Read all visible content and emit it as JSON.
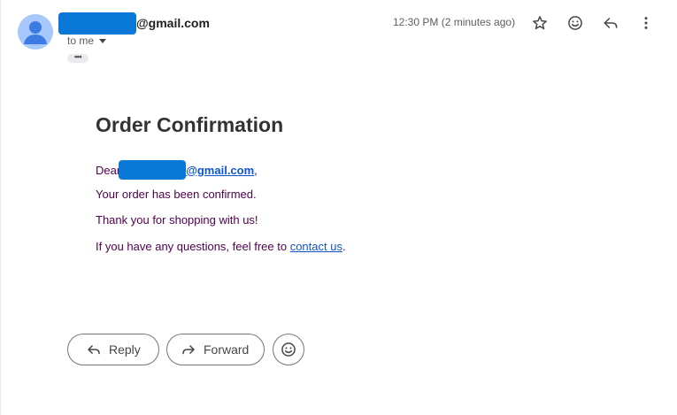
{
  "header": {
    "sender_visible_suffix": "@gmail.com",
    "recipient_label": "to me",
    "trimmed_content_label": "•••",
    "timestamp": "12:30 PM (2 minutes ago)",
    "icons": [
      "star-icon",
      "emoji-icon",
      "reply-icon",
      "more-vert-icon"
    ]
  },
  "message": {
    "title": "Order Confirmation",
    "greeting_prefix": "Dear",
    "greeting_email_suffix": "@gmail.com",
    "greeting_end": ",",
    "line1": "Your order has been confirmed.",
    "line2": "Thank you for shopping with us!",
    "line3_prefix": "If you have any questions, feel free to ",
    "line3_link": "contact us",
    "line3_suffix": "."
  },
  "actions": {
    "reply_label": "Reply",
    "forward_label": "Forward"
  },
  "colors": {
    "redaction": "#0a78d7",
    "link": "#1155cc",
    "body_text": "#500050",
    "avatar_bg": "#a8c7fa",
    "avatar_fg": "#3b7be4"
  }
}
